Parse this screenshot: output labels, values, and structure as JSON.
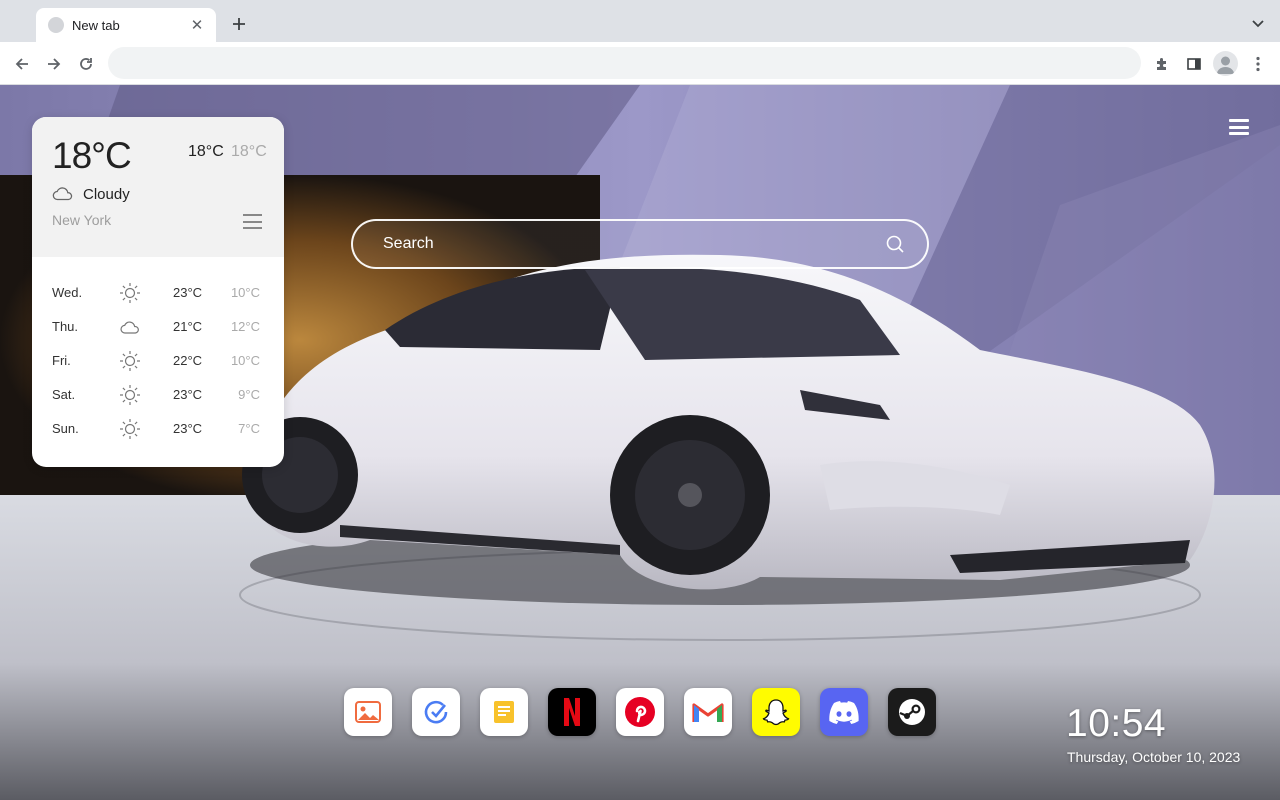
{
  "browser": {
    "tab_title": "New tab",
    "address_placeholder": ""
  },
  "weather": {
    "current_temp": "18°C",
    "high": "18°C",
    "low": "18°C",
    "condition": "Cloudy",
    "city": "New York",
    "forecast": [
      {
        "day": "Wed.",
        "icon": "sun-icon",
        "high": "23°C",
        "low": "10°C"
      },
      {
        "day": "Thu.",
        "icon": "cloud-icon",
        "high": "21°C",
        "low": "12°C"
      },
      {
        "day": "Fri.",
        "icon": "sun-icon",
        "high": "22°C",
        "low": "10°C"
      },
      {
        "day": "Sat.",
        "icon": "sun-icon",
        "high": "23°C",
        "low": "9°C"
      },
      {
        "day": "Sun.",
        "icon": "sun-icon",
        "high": "23°C",
        "low": "7°C"
      }
    ]
  },
  "search": {
    "placeholder": "Search"
  },
  "dock": {
    "apps": [
      {
        "name": "gallery",
        "icon": "gallery-icon",
        "bg": "#ffffff"
      },
      {
        "name": "tasks",
        "icon": "check-icon",
        "bg": "#ffffff"
      },
      {
        "name": "notes",
        "icon": "notes-icon",
        "bg": "#ffffff"
      },
      {
        "name": "netflix",
        "icon": "netflix-icon",
        "bg": "#000000"
      },
      {
        "name": "pinterest",
        "icon": "pinterest-icon",
        "bg": "#ffffff"
      },
      {
        "name": "gmail",
        "icon": "gmail-icon",
        "bg": "#ffffff"
      },
      {
        "name": "snapchat",
        "icon": "snapchat-icon",
        "bg": "#fffc00"
      },
      {
        "name": "discord",
        "icon": "discord-icon",
        "bg": "#5865f2"
      },
      {
        "name": "steam",
        "icon": "steam-icon",
        "bg": "#1b1b1b"
      }
    ]
  },
  "clock": {
    "time": "10:54",
    "date": "Thursday, October 10, 2023"
  },
  "colors": {
    "accent": "#5865f2",
    "tabstrip": "#dee1e6"
  }
}
